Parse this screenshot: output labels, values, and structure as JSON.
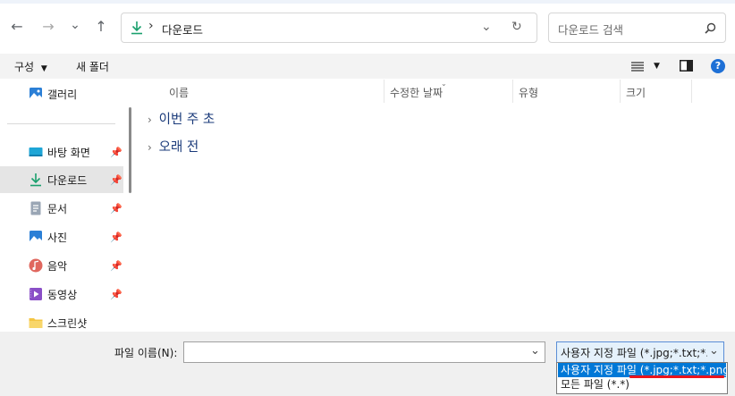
{
  "nav": {
    "back": "←",
    "forward": "→",
    "recent": "⌄",
    "up": "↑"
  },
  "address": {
    "crumb_separator": "›",
    "current_folder": "다운로드",
    "dropdown": "⌄",
    "refresh": "↻"
  },
  "search": {
    "placeholder": "다운로드 검색"
  },
  "toolbar": {
    "organize": "구성",
    "new_folder": "새 폴더",
    "help": "?"
  },
  "sidebar": {
    "items": [
      {
        "label": "갤러리",
        "icon": "gallery-icon",
        "pinned": false
      },
      {
        "label": "바탕 화면",
        "icon": "desktop-icon",
        "pinned": true
      },
      {
        "label": "다운로드",
        "icon": "download-icon",
        "pinned": true,
        "selected": true
      },
      {
        "label": "문서",
        "icon": "document-icon",
        "pinned": true
      },
      {
        "label": "사진",
        "icon": "pictures-icon",
        "pinned": true
      },
      {
        "label": "음악",
        "icon": "music-icon",
        "pinned": true
      },
      {
        "label": "동영상",
        "icon": "videos-icon",
        "pinned": true
      },
      {
        "label": "스크린샷",
        "icon": "folder-icon",
        "pinned": false
      }
    ]
  },
  "columns": [
    "이름",
    "수정한 날짜",
    "유형",
    "크기"
  ],
  "groups": [
    "이번 주 초",
    "오래 전"
  ],
  "bottom": {
    "filename_label": "파일 이름(N):",
    "filename_value": "",
    "filetype_selected": "사용자 지정 파일 (*.jpg;*.txt;*.p",
    "filetype_options": [
      "사용자 지정 파일 (*.jpg;*.txt;*.png)",
      "모든 파일 (*.*)"
    ]
  },
  "colors": {
    "accent": "#0078d7",
    "download_green": "#1aa06d",
    "annotation_red": "#e8141c"
  }
}
